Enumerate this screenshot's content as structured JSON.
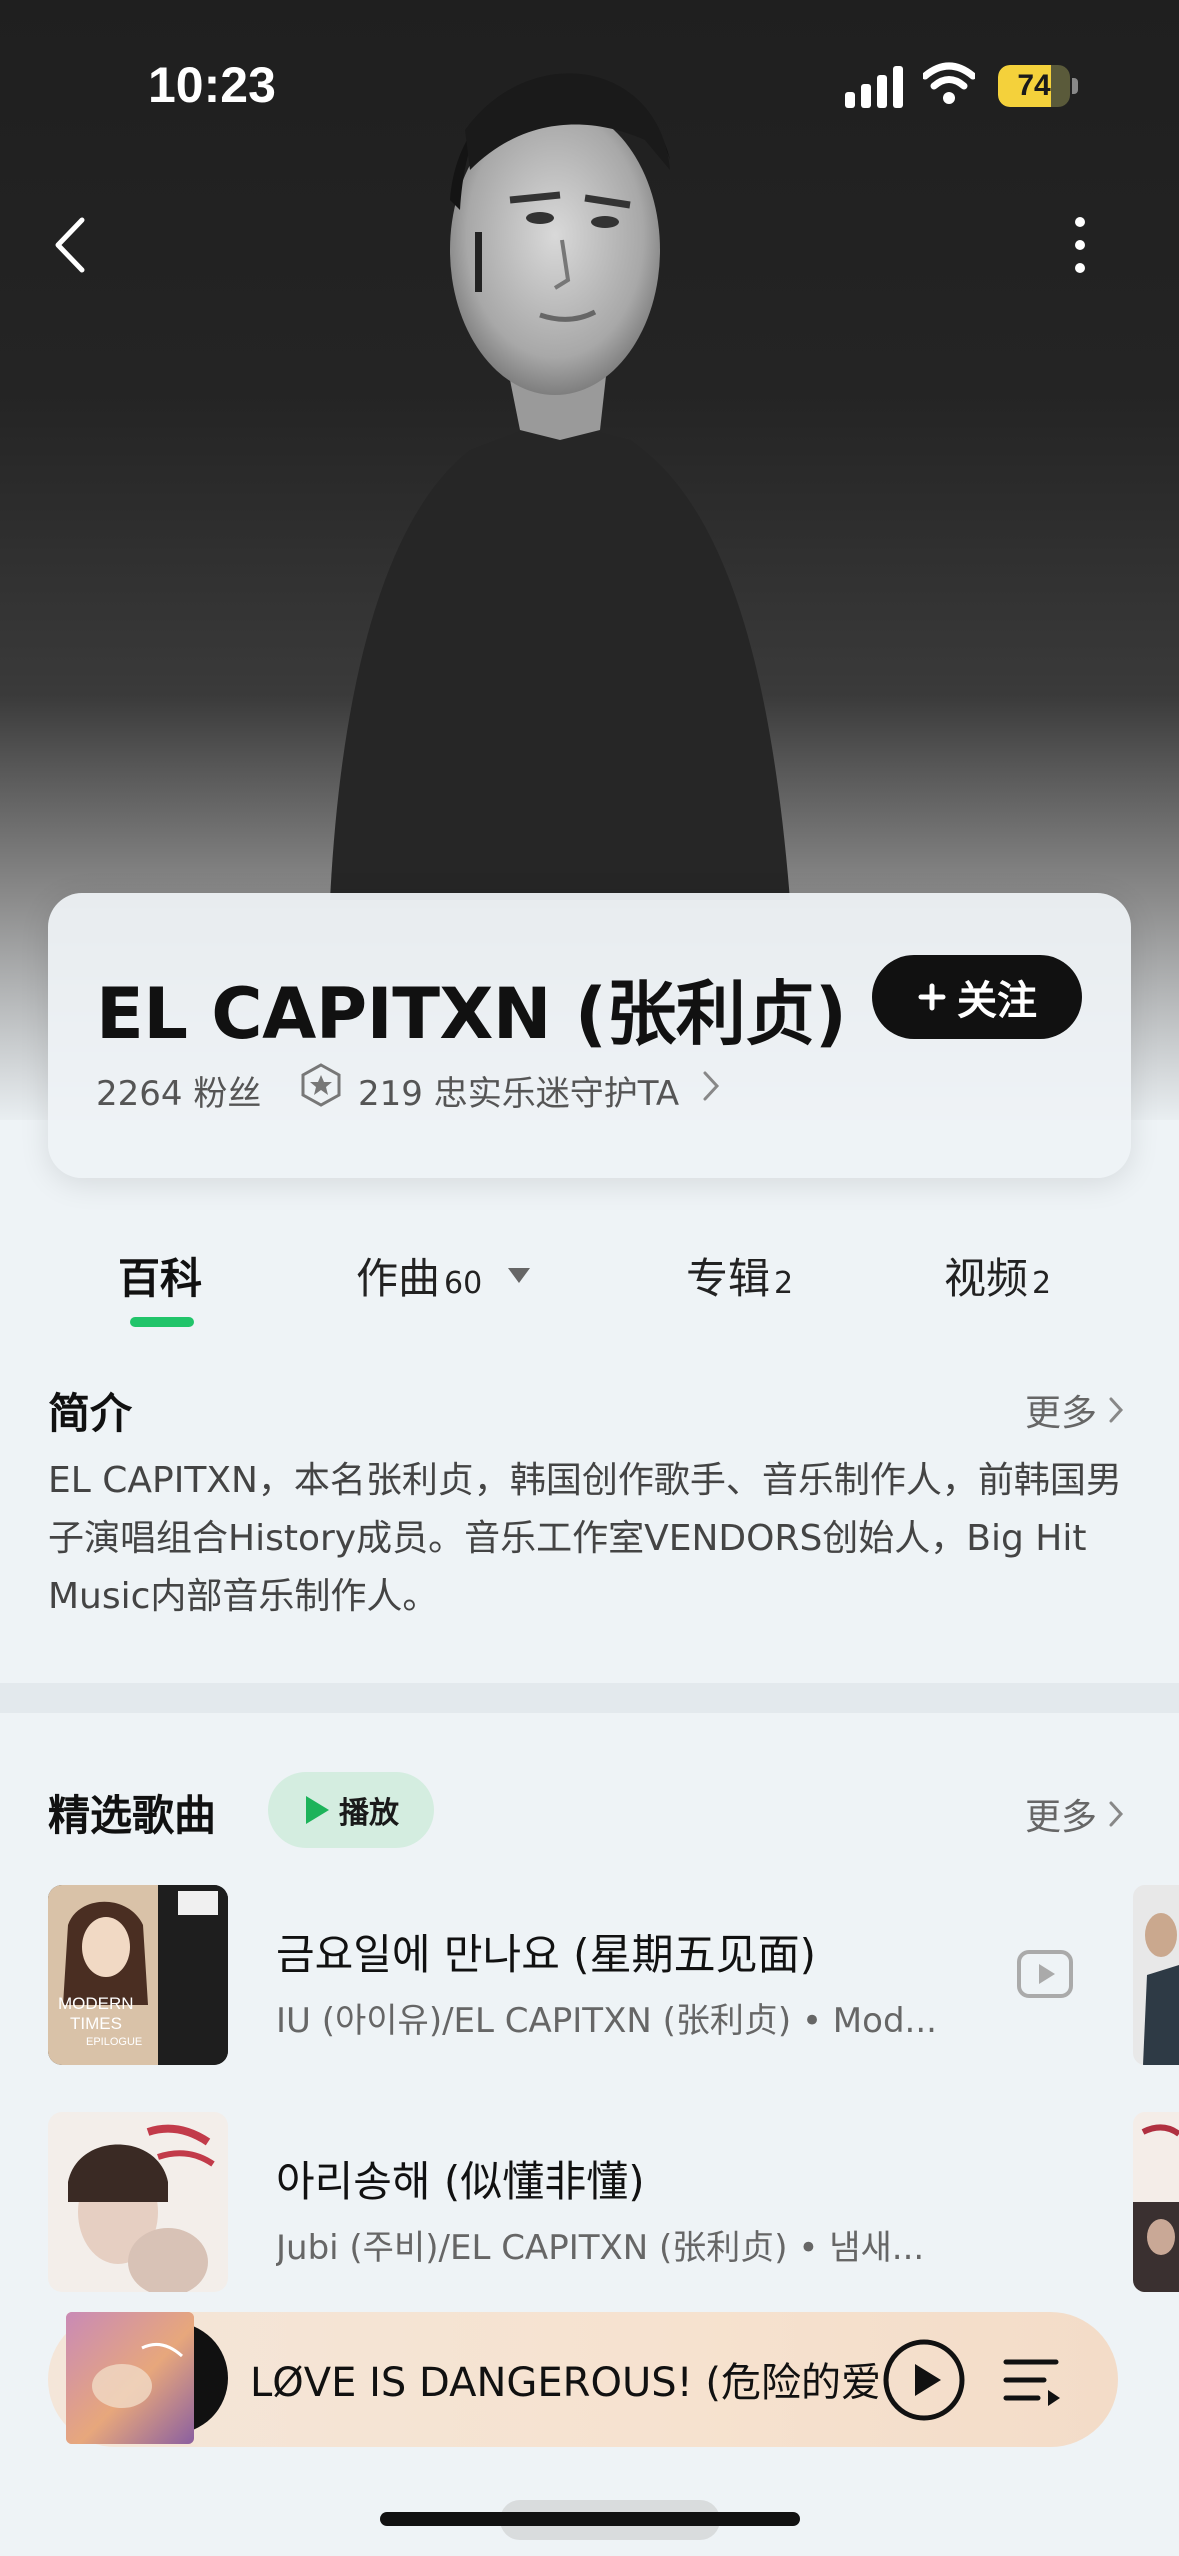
{
  "status_bar": {
    "time": "10:23",
    "battery": "74",
    "battery_level": 0.74
  },
  "artist": {
    "name": "EL CAPITXN (张利贞)",
    "follow_label": "关注",
    "fans": "2264 粉丝",
    "guard_text": "219 忠实乐迷守护TA"
  },
  "tabs": [
    {
      "label": "百科",
      "count": "",
      "active": true
    },
    {
      "label": "作曲",
      "count": "60",
      "active": false
    },
    {
      "label": "专辑",
      "count": "2",
      "active": false
    },
    {
      "label": "视频",
      "count": "2",
      "active": false
    }
  ],
  "intro": {
    "title": "简介",
    "more": "更多",
    "text": "EL CAPITXN，本名张利贞，韩国创作歌手、音乐制作人，前韩国男子演唱组合History成员。音乐工作室VENDORS创始人，Big Hit Music内部音乐制作人。"
  },
  "featured": {
    "title": "精选歌曲",
    "play_label": "播放",
    "more": "更多",
    "songs": [
      {
        "title": "금요일에 만나요 (星期五见面)",
        "meta": "IU (아이유)/EL CAPITXN (张利贞) • Mod...",
        "cover_text_1": "MODERN",
        "cover_text_2": "TIMES",
        "cover_text_3": "EPILOGUE"
      },
      {
        "title": "아리송해 (似懂非懂)",
        "meta": "Jubi (주비)/EL CAPITXN (张利贞) • 냄새..."
      }
    ]
  },
  "mini_player": {
    "title": "LØVE IS DANGEROUS! (危险的爱"
  }
}
